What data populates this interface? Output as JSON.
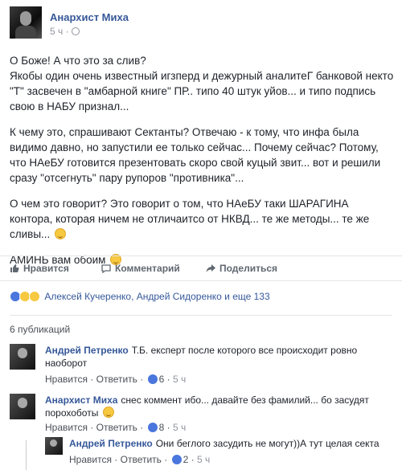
{
  "author": {
    "name": "Анархист Миха",
    "time": "5 ч ·"
  },
  "body": {
    "p1": "О Боже! А что это за слив?\nЯкобы один очень известный игзперд и дежурный аналитеГ банковой некто \"Т\" засвечен в \"амбарной книге\" ПР.. типо 40 штук уйов... и типо подпись свою в НАБУ признал...",
    "p2": "К чему это, спрашивают Сектанты? Отвечаю - к тому, что инфа была видимо давно, но запустили ее только сейчас... Почему сейчас? Потому, что НАеБУ готовится презентовать скоро свой куцый звит... вот и решили сразу \"отсегнуть\" пару рупоров \"противника\"...",
    "p3": "О чем это говорит? Это говорит о том, что НАеБУ таки ШАРАГИНА контора, которая ничем не отличаитсо от НКВД... те же методы... те же сливы...",
    "p4": "АМИНЬ вам обоим"
  },
  "actions": {
    "like": "Нравится",
    "comment": "Комментарий",
    "share": "Поделиться"
  },
  "reactions": {
    "names": "Алексей Кучеренко, Андрей Сидоренко и еще 133"
  },
  "comments_count": "6 публикаций",
  "comments": [
    {
      "name": "Андрей Петренко",
      "text": "Т.Б. експерт после которого все происходит ровно наоборот",
      "like_label": "Нравится",
      "reply_label": "Ответить",
      "likes": "6",
      "time": "5 ч"
    },
    {
      "name": "Анархист Миха",
      "text": "снес коммент ибо... давайте без фамилий... бо засудят порохоботы",
      "like_label": "Нравится",
      "reply_label": "Ответить",
      "likes": "8",
      "time": "5 ч"
    },
    {
      "name": "Андрей Петренко",
      "text": "Они беглого засудить не могут))А тут целая секта",
      "like_label": "Нравится",
      "reply_label": "Ответить",
      "likes": "2",
      "time": "5 ч"
    }
  ],
  "colors": {
    "link": "#365899",
    "like": "#4a76dd",
    "emoji": "#f7c940"
  },
  "icons": [
    "globe-icon",
    "thumbs-up-icon",
    "comment-icon",
    "share-icon",
    "like-reaction-icon",
    "haha-reaction-icon",
    "wow-reaction-icon",
    "smile-emoji-icon"
  ]
}
